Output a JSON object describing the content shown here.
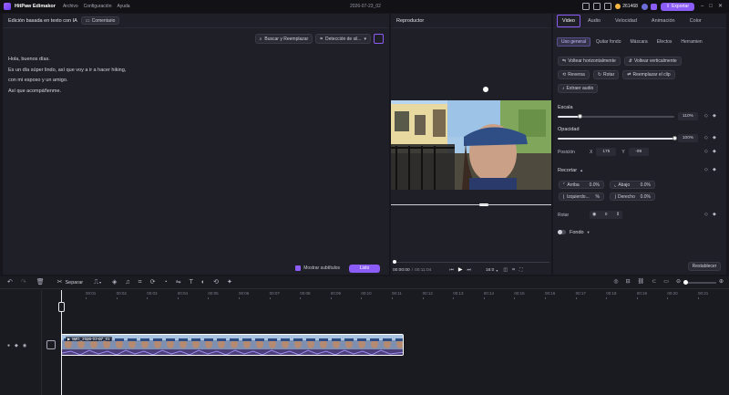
{
  "app": {
    "name": "HitPaw Edimakor",
    "date_title": "2026-07-23_02"
  },
  "menu": [
    "Archivo",
    "Configuración",
    "Ayuda"
  ],
  "header": {
    "coins": "261468",
    "export_label": "Exportar"
  },
  "transcript": {
    "title": "Edición basada en texto con IA",
    "comment_label": "Comentario",
    "search_replace_label": "Buscar y Reemplazar",
    "detect_label": "Detección de sil...",
    "lines": [
      "Hola, buenos días.",
      "Es un día súper lindo, así que voy a ir a hacer hiking,",
      "con mi esposo y un amigo.",
      "Así que acompáñenme."
    ],
    "show_subtitles_label": "Mostrar subtítulos",
    "done_label": "Listo"
  },
  "player": {
    "title": "Reproductor",
    "time_current": "00:00:00",
    "time_total": "00:11:04",
    "speed": "16:0"
  },
  "props": {
    "tabs": [
      "Video",
      "Audio",
      "Velocidad",
      "Animación",
      "Color"
    ],
    "active_tab": "Video",
    "subtabs": [
      "Uso general",
      "Quitar fondo",
      "Máscara",
      "Efectos",
      "Herramien"
    ],
    "flip_h": "Voltear horizontalmente",
    "flip_v": "Voltear verticalmente",
    "reverse": "Reversa",
    "rotate": "Rotar",
    "replace_clip": "Reemplazar el clip",
    "extract_audio": "Extraer audio",
    "scale_label": "Escala",
    "scale_value": "110%",
    "scale_fraction": 0.19,
    "opacity_label": "Opacidad",
    "opacity_value": "100%",
    "opacity_fraction": 1.0,
    "position_label": "Posición",
    "pos_x_label": "X",
    "pos_x": "175",
    "pos_y_label": "Y",
    "pos_y": "-99",
    "crop_label": "Recortar",
    "crop_top_label": "Arriba",
    "crop_top": "0.0%",
    "crop_bottom_label": "Abajo",
    "crop_bottom": "0.0%",
    "crop_left_label": "Izquierdo...",
    "crop_left": "%",
    "crop_right_label": "Derecho",
    "crop_right": "0.0%",
    "rotate_label": "Rotar",
    "rotate_value": "0",
    "background_label": "Fondo",
    "reset_label": "Restablecer"
  },
  "timeline": {
    "split_label": "Separar",
    "ruler": [
      "00:01",
      "00:02",
      "00:03",
      "00:04",
      "00:05",
      "00:06",
      "00:07",
      "00:08",
      "00:09",
      "00:10",
      "00:11",
      "00:12",
      "00:13",
      "00:14",
      "00:15",
      "00:16",
      "00:17",
      "00:18",
      "00:19",
      "00:20",
      "00:21"
    ],
    "clip_label": "IMG_2026-03-07_01"
  },
  "colors": {
    "accent": "#8b5cf6",
    "panel": "#1f1f27",
    "bg": "#16161c"
  }
}
